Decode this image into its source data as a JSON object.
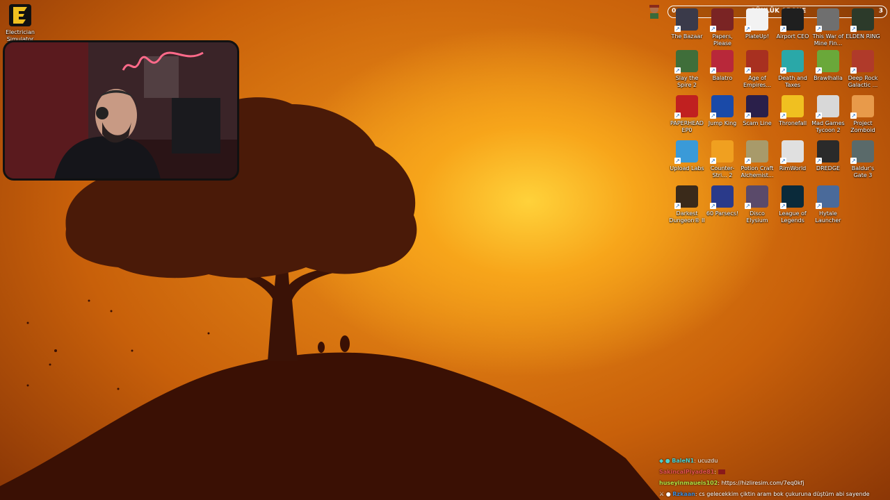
{
  "desktop": {
    "top_left_icon": {
      "label": "Electrician Simulator",
      "icon": "electrician-icon"
    },
    "icons": [
      {
        "label": "The Bazaar",
        "icon": "bazaar-icon",
        "color": "#3a3a4a"
      },
      {
        "label": "Papers, Please",
        "icon": "papers-please-icon",
        "color": "#7a2424"
      },
      {
        "label": "PlateUp!",
        "icon": "plateup-icon",
        "color": "#f2f2f2"
      },
      {
        "label": "Airport CEO",
        "icon": "airport-ceo-icon",
        "color": "#1f1f1f"
      },
      {
        "label": "This War of Mine Fin...",
        "icon": "this-war-of-mine-icon",
        "color": "#6f6f6f"
      },
      {
        "label": "ELDEN RING",
        "icon": "elden-ring-icon",
        "color": "#2c3a2a"
      },
      {
        "label": "Slay the Spire 2",
        "icon": "slay-the-spire-icon",
        "color": "#3f6e3a"
      },
      {
        "label": "Balatro",
        "icon": "balatro-icon",
        "color": "#b8283a"
      },
      {
        "label": "Age of Empires...",
        "icon": "age-of-empires-icon",
        "color": "#a83020"
      },
      {
        "label": "Death and Taxes",
        "icon": "death-and-taxes-icon",
        "color": "#2aa8a8"
      },
      {
        "label": "Brawlhalla",
        "icon": "brawlhalla-icon",
        "color": "#6aa83a"
      },
      {
        "label": "Deep Rock Galactic ...",
        "icon": "deep-rock-galactic-icon",
        "color": "#b03a2a"
      },
      {
        "label": "PAPERHEAD EP0",
        "icon": "paperhead-icon",
        "color": "#c02020"
      },
      {
        "label": "Jump King",
        "icon": "jump-king-icon",
        "color": "#1a4aa8"
      },
      {
        "label": "Scam Line",
        "icon": "scam-line-icon",
        "color": "#2a1f4a"
      },
      {
        "label": "Thronefall",
        "icon": "thronefall-icon",
        "color": "#f0c020"
      },
      {
        "label": "Mad Games Tycoon 2",
        "icon": "mad-games-tycoon-icon",
        "color": "#d8d8d8"
      },
      {
        "label": "Project Zomboid",
        "icon": "project-zomboid-icon",
        "color": "#e89a4a"
      },
      {
        "label": "Upload Labs",
        "icon": "upload-labs-icon",
        "color": "#3a9ad8"
      },
      {
        "label": "Counter-Stri... 2",
        "icon": "counter-strike-icon",
        "color": "#f0a020"
      },
      {
        "label": "Potion Craft Alchemist...",
        "icon": "potion-craft-icon",
        "color": "#a89a6a"
      },
      {
        "label": "RimWorld",
        "icon": "rimworld-icon",
        "color": "#e0e0e0"
      },
      {
        "label": "DREDGE",
        "icon": "dredge-icon",
        "color": "#2a2a2a"
      },
      {
        "label": "Baldur's Gate 3",
        "icon": "baldurs-gate-icon",
        "color": "#5a6a6a"
      },
      {
        "label": "Darkest Dungeon® II",
        "icon": "darkest-dungeon-icon",
        "color": "#3a2a1a"
      },
      {
        "label": "60 Parsecs!",
        "icon": "sixty-parsecs-icon",
        "color": "#2a3a8a"
      },
      {
        "label": "Disco Elysium",
        "icon": "disco-elysium-icon",
        "color": "#5a4a6a"
      },
      {
        "label": "League of Legends",
        "icon": "league-of-legends-icon",
        "color": "#0a2a3a"
      },
      {
        "label": "Hytale Launcher",
        "icon": "hytale-icon",
        "color": "#4a6a9a"
      }
    ]
  },
  "subscriber_goal": {
    "current": "0",
    "label": "GÜNLÜK ABONE",
    "goal": "3",
    "progress": 0
  },
  "chat": [
    {
      "user": "BaleN1",
      "message": "ucuzdu",
      "user_color": "#4ad0d0"
    },
    {
      "user": "SakincalPiyade81",
      "message": "",
      "user_color": "#e05050"
    },
    {
      "user": "huseyinmaueis102",
      "message": "https://hizliresim.com/7eq0kfj",
      "user_color": "#b0e040"
    },
    {
      "user": "Rzkaan",
      "message": "cs gelecekkim çiktin aram bok çukuruna düştüm abi sayende",
      "user_color": "#3a8ad8"
    }
  ],
  "colors": {
    "wallpaper_glow": "#ffd23a",
    "wallpaper_base": "#c96a08"
  }
}
